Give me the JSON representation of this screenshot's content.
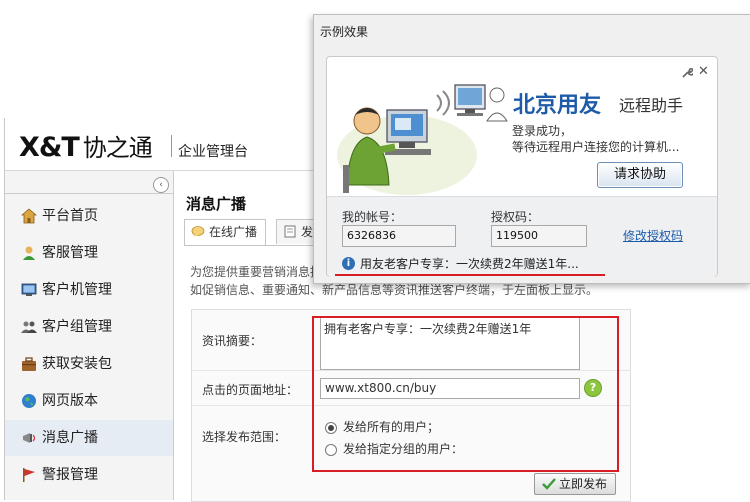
{
  "console": {
    "brand_logo": "X&T",
    "brand_name": "协之通",
    "brand_subtitle": "企业管理台",
    "sidebar": {
      "items": [
        {
          "label": "平台首页",
          "icon": "home-icon"
        },
        {
          "label": "客服管理",
          "icon": "user-icon"
        },
        {
          "label": "客户机管理",
          "icon": "monitor-icon"
        },
        {
          "label": "客户组管理",
          "icon": "user-group-icon"
        },
        {
          "label": "获取安装包",
          "icon": "briefcase-icon"
        },
        {
          "label": "网页版本",
          "icon": "globe-icon"
        },
        {
          "label": "消息广播",
          "icon": "megaphone-icon"
        },
        {
          "label": "警报管理",
          "icon": "flag-icon"
        }
      ],
      "active": "消息广播"
    },
    "main": {
      "title": "消息广播",
      "tabs": [
        {
          "label": "在线广播"
        },
        {
          "label": "发"
        }
      ],
      "intro_line1": "为您提供重要营销消息推",
      "intro_line2": "如促销信息、重要通知、新产品信息等资讯推送客户终端，于左面板上显示。",
      "form": {
        "summary_label": "资讯摘要：",
        "summary_value": "拥有老客户专享：一次续费2年赠送1年",
        "url_label": "点击的页面地址：",
        "url_value": "www.xt800.cn/buy",
        "scope_label": "选择发布范围：",
        "scope_options": [
          {
            "label": "发给所有的用户；",
            "selected": true
          },
          {
            "label": "发给指定分组的用户：",
            "selected": false
          }
        ],
        "publish_label": "立即发布"
      }
    }
  },
  "popup": {
    "window_title": "示例效果",
    "brand_title": "北京用友",
    "brand_subtitle": "远程助手",
    "status_line1": "登录成功，",
    "status_line2": "等待远程用户连接您的计算机...",
    "help_button": "请求协助",
    "account_label": "我的帐号：",
    "account_value": "6326836",
    "auth_label": "授权码：",
    "auth_value": "119500",
    "change_code_link": "修改授权码",
    "promo_text": "用友老客户专享：一次续费2年赠送1年..."
  },
  "colors": {
    "highlight_red": "#d81e24",
    "brand_blue": "#1d5aa8",
    "active_sidebar_bg": "#e6ecf3"
  }
}
